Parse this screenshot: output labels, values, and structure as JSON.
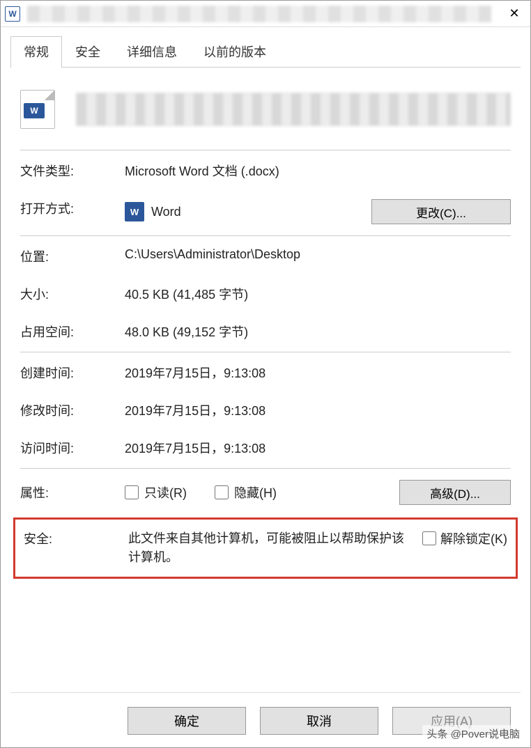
{
  "titlebar": {
    "close": "✕"
  },
  "tabs": [
    "常规",
    "安全",
    "详细信息",
    "以前的版本"
  ],
  "icon_badge": "W",
  "fields": {
    "file_type_label": "文件类型:",
    "file_type_value": "Microsoft Word 文档 (.docx)",
    "open_with_label": "打开方式:",
    "open_with_value": "Word",
    "change_btn": "更改(C)...",
    "location_label": "位置:",
    "location_value": "C:\\Users\\Administrator\\Desktop",
    "size_label": "大小:",
    "size_value": "40.5 KB (41,485 字节)",
    "disk_label": "占用空间:",
    "disk_value": "48.0 KB (49,152 字节)",
    "created_label": "创建时间:",
    "created_value": "2019年7月15日，9:13:08",
    "modified_label": "修改时间:",
    "modified_value": "2019年7月15日，9:13:08",
    "accessed_label": "访问时间:",
    "accessed_value": "2019年7月15日，9:13:08",
    "attr_label": "属性:",
    "readonly_label": "只读(R)",
    "hidden_label": "隐藏(H)",
    "advanced_btn": "高级(D)...",
    "security_label": "安全:",
    "security_msg": "此文件来自其他计算机，可能被阻止以帮助保护该计算机。",
    "unlock_label": "解除锁定(K)"
  },
  "buttons": {
    "ok": "确定",
    "cancel": "取消",
    "apply": "应用(A)"
  },
  "watermark": "头条 @Pover说电脑"
}
